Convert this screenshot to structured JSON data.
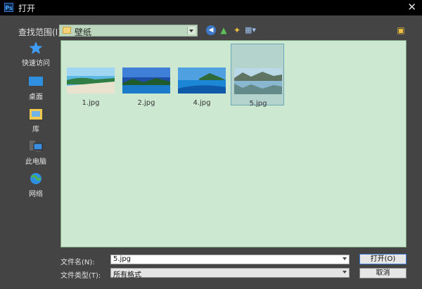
{
  "window": {
    "title": "打开",
    "app_icon": "Ps",
    "close_glyph": "✕"
  },
  "lookin": {
    "label": "查找范围(I):",
    "value": "壁纸"
  },
  "toolbar": {
    "back_icon": "back-icon",
    "up_icon": "up-folder-icon",
    "newfolder_icon": "new-folder-icon",
    "view_icon": "view-menu-icon",
    "right_icon": "folder-icon"
  },
  "places": [
    {
      "label": "快速访问",
      "icon": "star-icon"
    },
    {
      "label": "桌面",
      "icon": "desktop-icon"
    },
    {
      "label": "库",
      "icon": "library-icon"
    },
    {
      "label": "此电脑",
      "icon": "computer-icon"
    },
    {
      "label": "网络",
      "icon": "network-icon"
    }
  ],
  "files": [
    {
      "name": "1.jpg",
      "selected": false
    },
    {
      "name": "2.jpg",
      "selected": false
    },
    {
      "name": "4.jpg",
      "selected": false
    },
    {
      "name": "5.jpg",
      "selected": true
    }
  ],
  "bottom": {
    "filename_label": "文件名(N):",
    "filename_value": "5.jpg",
    "filetype_label": "文件类型(T):",
    "filetype_value": "所有格式",
    "open_label": "打开(O)",
    "cancel_label": "取消"
  },
  "colors": {
    "file_area_bg": "#cde8d1",
    "selected_tile": "#b4d3cc",
    "dialog_bg": "#444444"
  }
}
